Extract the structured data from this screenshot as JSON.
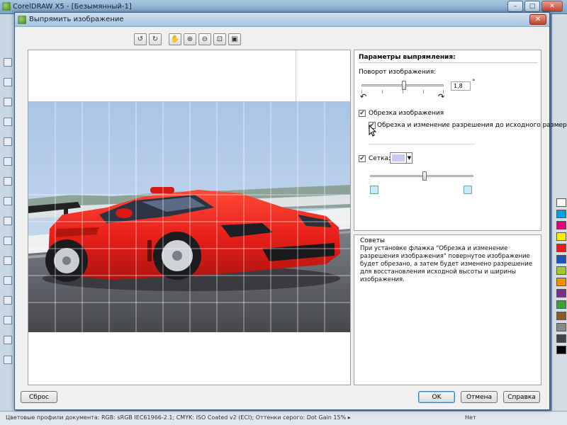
{
  "app": {
    "title": "CorelDRAW X5 - [Безымянный-1]",
    "status_text": "Цветовые профили документа: RGB: sRGB IEC61966-2.1; CMYK: ISO Coated v2 (ECI); Оттенки серого: Dot Gain 15% ▸",
    "status_right": "Нет"
  },
  "dialog": {
    "title": "Выпрямить изображение",
    "close_symbol": "✕",
    "toolbar": [
      {
        "name": "rotate-left-icon",
        "glyph": "↺"
      },
      {
        "name": "rotate-right-icon",
        "glyph": "↻"
      },
      {
        "name": "pan-hand-icon",
        "glyph": "✋"
      },
      {
        "name": "zoom-in-icon",
        "glyph": "⊕"
      },
      {
        "name": "zoom-out-icon",
        "glyph": "⊖"
      },
      {
        "name": "fit-window-icon",
        "glyph": "⊡"
      },
      {
        "name": "actual-size-icon",
        "glyph": "▣"
      }
    ]
  },
  "panel": {
    "title": "Параметры выпрямления:",
    "rotation_label": "Поворот изображения:",
    "rotation_value": "1,8",
    "rotation_unit": "°",
    "rotation_slider_level": 0.52,
    "rotate_ccw_glyph": "↶",
    "rotate_cw_glyph": "↷",
    "crop_label": "Обрезка изображения",
    "crop_checked": true,
    "crop_resample_label": "Обрезка и изменение разрешения до исходного размера",
    "crop_resample_checked": true,
    "grid_label": "Сетка:",
    "grid_checked": true,
    "grid_color": "#c9c9f5",
    "grid_slider_level": 0.53,
    "grid_slider_min_color": "#c8eaf2",
    "grid_slider_max_color": "#c8eaf2",
    "dropdown_arrow": "▼",
    "check_glyph": "✔"
  },
  "tips": {
    "title": "Советы",
    "text": "При установке флажка \"Обрезка и изменение разрешения изображения\" повернутое изображение будет обрезано, а затем будет изменено разрешение для восстановления исходной высоты и ширины изображения."
  },
  "buttons": {
    "reset": "Сброс",
    "ok": "OK",
    "cancel": "Отмена",
    "help": "Справка"
  },
  "colors": {
    "car_red": "#e8201a",
    "sky": "#b6cfe8",
    "track": "#55575d",
    "accent_blue": "#3c7fb1"
  }
}
